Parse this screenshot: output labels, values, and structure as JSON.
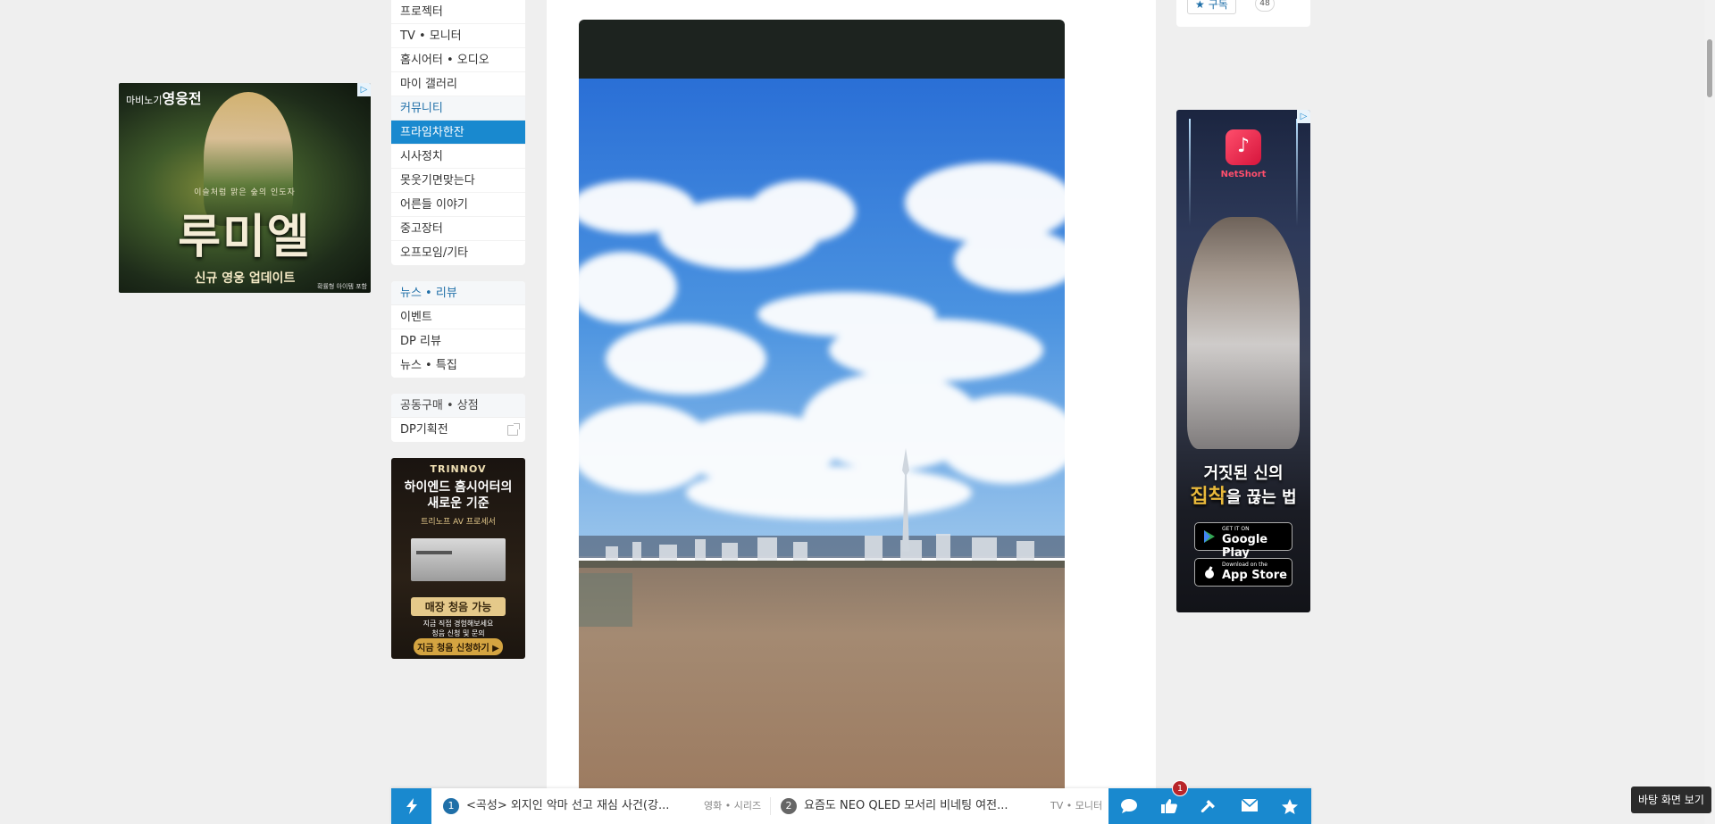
{
  "left_ad": {
    "brand_prefix": "마비노기",
    "brand_main": "영웅전",
    "subtitle": "이슬처럼 맑은 숲의 인도자",
    "title": "루미엘",
    "update": "신규 영웅 업데이트",
    "note": "확률형 아이템 포함",
    "ad_tag": "▷"
  },
  "sidebar": {
    "group1_items": [
      "프로젝터",
      "TV • 모니터",
      "홈시어터 • 오디오",
      "마이 갤러리"
    ],
    "community_head": "커뮤니티",
    "community_items": [
      "프라임차한잔",
      "시사정치",
      "못웃기면맞는다",
      "어른들 이야기",
      "중고장터",
      "오프모임/기타"
    ],
    "news_head": "뉴스 • 리뷰",
    "news_items": [
      "이벤트",
      "DP 리뷰",
      "뉴스 • 특집"
    ],
    "shop_head": "공동구매 • 상점",
    "shop_items": [
      "DP기획전"
    ]
  },
  "side_ad": {
    "logo": "TRINNOV",
    "line1": "하이엔드 홈시어터의",
    "line2": "새로운 기준",
    "line3": "트리노프 AV 프로세서",
    "badge": "매장 청음 가능",
    "line4": "지금 직접 경험해보세요",
    "line5": "청음 신청 및 문의",
    "cta": "지금 청음 신청하기 ▶"
  },
  "subscribe": {
    "label": "구독",
    "count": "48"
  },
  "right_ad": {
    "app_name": "NetShort",
    "title_line1": "거짓된 신의",
    "title_gold": "집착",
    "title_line2": "을 끊는 법",
    "google_small": "GET IT ON",
    "google_big": "Google Play",
    "apple_small": "Download on the",
    "apple_big": "App Store",
    "ad_tag": "▷"
  },
  "bottom_bar": {
    "items": [
      {
        "num": "1",
        "title": "<곡성> 외지인 악마 선고 재심 사건(강...",
        "category": "영화 • 시리즈"
      },
      {
        "num": "2",
        "title": "요즘도 NEO QLED 모서리 비네팅 여전...",
        "category": "TV • 모니터"
      }
    ],
    "notification_count": "1"
  },
  "desktop_tip": "바탕 화면 보기",
  "colors": {
    "accent": "#1989cf",
    "badge": "#b8252a",
    "num1": "#1f6fa8",
    "num2": "#666666"
  },
  "icons": [
    "bolt-icon",
    "chat-icon",
    "thumbs-up-icon",
    "hammer-icon",
    "mail-icon",
    "star-icon",
    "external-link-icon"
  ]
}
